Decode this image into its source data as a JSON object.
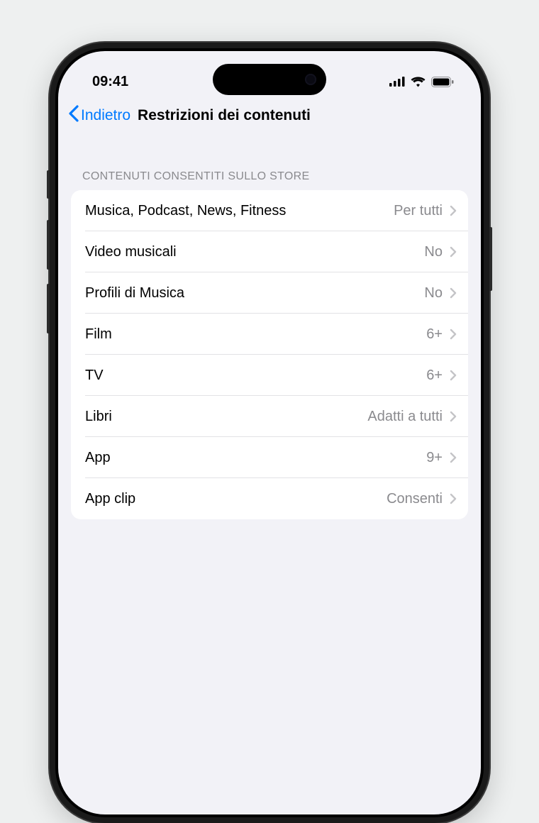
{
  "status": {
    "time": "09:41"
  },
  "nav": {
    "back": "Indietro",
    "title": "Restrizioni dei contenuti"
  },
  "section": {
    "header": "CONTENUTI CONSENTITI SULLO STORE"
  },
  "rows": [
    {
      "label": "Musica, Podcast, News, Fitness",
      "value": "Per tutti"
    },
    {
      "label": "Video musicali",
      "value": "No"
    },
    {
      "label": "Profili di Musica",
      "value": "No"
    },
    {
      "label": "Film",
      "value": "6+"
    },
    {
      "label": "TV",
      "value": "6+"
    },
    {
      "label": "Libri",
      "value": "Adatti a tutti"
    },
    {
      "label": "App",
      "value": "9+"
    },
    {
      "label": "App clip",
      "value": "Consenti"
    }
  ],
  "colors": {
    "accent": "#007aff",
    "secondaryText": "#8a8a8e",
    "background": "#f2f2f7",
    "listBackground": "#ffffff"
  }
}
